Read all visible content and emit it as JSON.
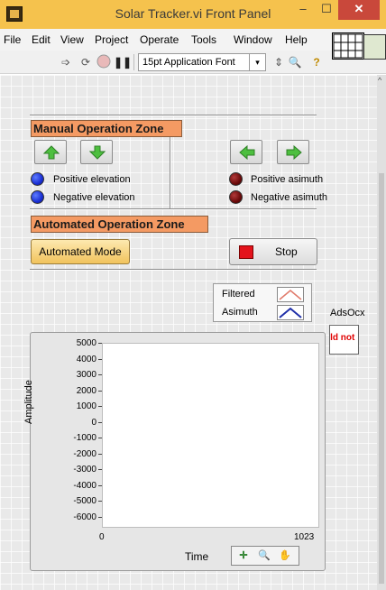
{
  "window": {
    "title": "Solar Tracker.vi Front Panel",
    "minimize_glyph": "–",
    "maximize_glyph": "☐",
    "close_glyph": "✕"
  },
  "menu": {
    "items": [
      {
        "label": "File"
      },
      {
        "label": "Edit"
      },
      {
        "label": "View"
      },
      {
        "label": "Project"
      },
      {
        "label": "Operate"
      },
      {
        "label": "Tools"
      },
      {
        "label": "Window"
      },
      {
        "label": "Help"
      }
    ]
  },
  "toolbar": {
    "icons": [
      "run-arrow-icon",
      "run-continuously-icon",
      "abort-icon",
      "pause-icon"
    ],
    "font_selector": "15pt Application Font",
    "extra_icons": [
      "align-objects-icon",
      "zoom-icon",
      "context-help-icon"
    ]
  },
  "manual_zone": {
    "title": "Manual Operation Zone",
    "positive_elevation": "Positive elevation",
    "negative_elevation": "Negative elevation",
    "positive_asimuth": "Positive asimuth",
    "negative_asimuth": "Negative asimuth"
  },
  "automated_zone": {
    "title": "Automated Operation Zone",
    "mode_button": "Automated Mode",
    "stop_button": "Stop"
  },
  "legend": {
    "entries": [
      {
        "name": "Filtered",
        "color": "#e07a6a"
      },
      {
        "name": "Asimuth",
        "color": "#1f2fa8"
      }
    ]
  },
  "adsocx": {
    "label": "AdsOcx",
    "error_text": "uld not"
  },
  "graph": {
    "ylabel": "Amplitude",
    "xlabel": "Time",
    "yticks": [
      "5000",
      "4000",
      "3000",
      "2000",
      "1000",
      "0",
      "-1000",
      "-2000",
      "-3000",
      "-4000",
      "-5000",
      "-6000"
    ],
    "xticks": [
      "0",
      "1023"
    ]
  },
  "colors": {
    "title_bar": "#f5c24d",
    "panel": "#e9e9e9",
    "zone_label": "#f49a63",
    "led_on": "#1a2fd4",
    "led_off": "#6b0b0b",
    "stop_red": "#e3121b"
  }
}
